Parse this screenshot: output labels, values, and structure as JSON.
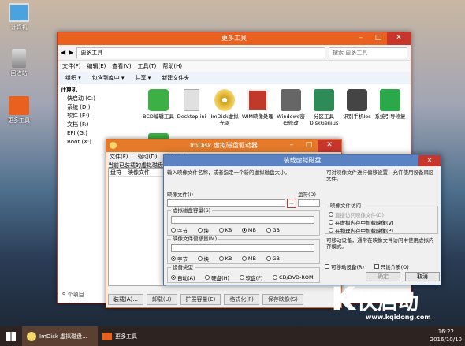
{
  "desktop": {
    "icons": [
      {
        "label": "计算机",
        "icon": "computer-icon"
      },
      {
        "label": "回收站",
        "icon": "recycle-bin-icon"
      },
      {
        "label": "更多工具",
        "icon": "folder-icon"
      }
    ]
  },
  "explorer": {
    "title": "更多工具",
    "path": "更多工具",
    "search_placeholder": "搜索 更多工具",
    "menu": [
      "文件(F)",
      "编辑(E)",
      "查看(V)",
      "工具(T)",
      "帮助(H)"
    ],
    "toolbar": [
      "组织 ▾",
      "包含到库中 ▾",
      "共享 ▾",
      "新建文件夹"
    ],
    "nav": [
      "计算机",
      "快启动 (C:)",
      "系统 (D:)",
      "软件 (E:)",
      "文档 (F:)",
      "EFI (G:)",
      "Boot (X:)"
    ],
    "files": [
      {
        "label": "BCD编辑工具",
        "color": "#3cb044"
      },
      {
        "label": "Desktop.ini",
        "color": "#dcdcdc"
      },
      {
        "label": "ImDisk虚拟光驱",
        "color": "#d4a017"
      },
      {
        "label": "WIM映像处理",
        "color": "#c0392b"
      },
      {
        "label": "Windows密码修改",
        "color": "#666666"
      },
      {
        "label": "分区工具DiskGenius",
        "color": "#2e8b57"
      },
      {
        "label": "识别手机Ios",
        "color": "#444444"
      },
      {
        "label": "系统引导修复",
        "color": "#2aa84a"
      }
    ],
    "status": "9 个项目"
  },
  "imdisk": {
    "title": "ImDisk 虚拟磁盘驱动器",
    "menu": [
      "文件(F)",
      "驱动(D)",
      "帮助(H)"
    ],
    "list_caption": "当前已装载的虚拟磁盘",
    "list_headers": [
      "盘符",
      "映像文件"
    ],
    "buttons": [
      "装载(A)...",
      "卸载(U)",
      "扩展容量(E)",
      "格式化(F)",
      "保存映像(S)"
    ]
  },
  "mount": {
    "title": "装载虚拟磁盘",
    "intro_left": "输入映像文件名称，或者指定一个新的虚拟磁盘大小。",
    "intro_right": "可对映像文件进行偏移设置，允许使用设备扇区文件。",
    "image_file_label": "映像文件(I)",
    "image_file_value": "",
    "browse_label": "...",
    "drive_label": "盘符(D)",
    "drive_value": "",
    "size_label": "虚拟磁盘容量(S)",
    "size_units": [
      "字节",
      "块",
      "KB",
      "MB",
      "GB"
    ],
    "size_selected": 3,
    "offset_label": "映像文件偏移量(M)",
    "offset_units": [
      "字节",
      "块",
      "KB",
      "MB",
      "GB"
    ],
    "offset_selected": 0,
    "device_type_label": "设备类型",
    "device_types": [
      "自动(A)",
      "硬盘(H)",
      "软盘(F)",
      "CD/DVD-ROM"
    ],
    "device_selected": 0,
    "access_label": "映像文件访问",
    "access_options": [
      "直接访问映像文件(D)",
      "在虚拟内存中加载映像(V)",
      "在物理内存中加载映像(P)"
    ],
    "access_selected": 0,
    "info_text": "可移动设备，通常在映像文件访问中使用虚拟内存模式。",
    "removable_label": "可移动设备(R)",
    "readonly_label": "只读介质(O)",
    "ok_label": "确定",
    "cancel_label": "取消"
  },
  "taskbar": {
    "items": [
      "ImDisk 虚拟磁盘...",
      "更多工具"
    ],
    "time": "16:22",
    "date": "2016/10/10"
  },
  "watermark": {
    "brand": "快启动",
    "url": "www.kqidong.com"
  }
}
